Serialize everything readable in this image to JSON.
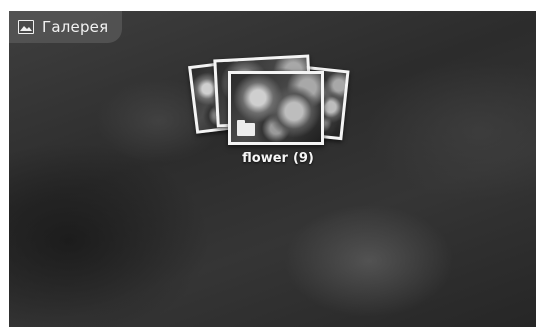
{
  "app": {
    "title": "Галерея",
    "icon": "gallery-icon"
  },
  "albums": [
    {
      "name": "flower",
      "count": "(9)",
      "icon": "folder-icon"
    }
  ],
  "colors": {
    "background": "#2f2f2f",
    "title_bar": "#5a5a5a",
    "text": "#f6f6f6",
    "photo_border": "#f4f4f4"
  }
}
